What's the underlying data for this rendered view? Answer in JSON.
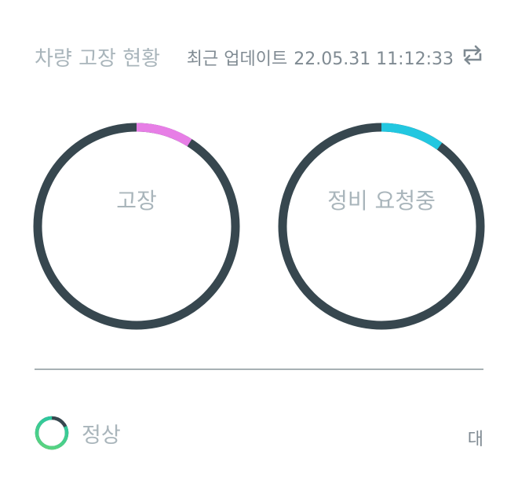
{
  "header": {
    "title": "차량 고장 현황",
    "update_label": "최근 업데이트",
    "update_time": "22.05.31 11:12:33",
    "refresh_icon": "refresh-icon"
  },
  "gauges": [
    {
      "label": "고장",
      "fraction": 0.09,
      "gradient": [
        "#f2808f",
        "#e77ee6"
      ]
    },
    {
      "label": "정비 요청중",
      "fraction": 0.1,
      "gradient": [
        "#2e7ef0",
        "#22c7e0"
      ]
    }
  ],
  "colors": {
    "track": "#37474f",
    "normal_gradient": [
      "#1fc4a7",
      "#62d67a"
    ]
  },
  "status": {
    "label": "정상",
    "count": "대",
    "fraction": 0.82
  }
}
